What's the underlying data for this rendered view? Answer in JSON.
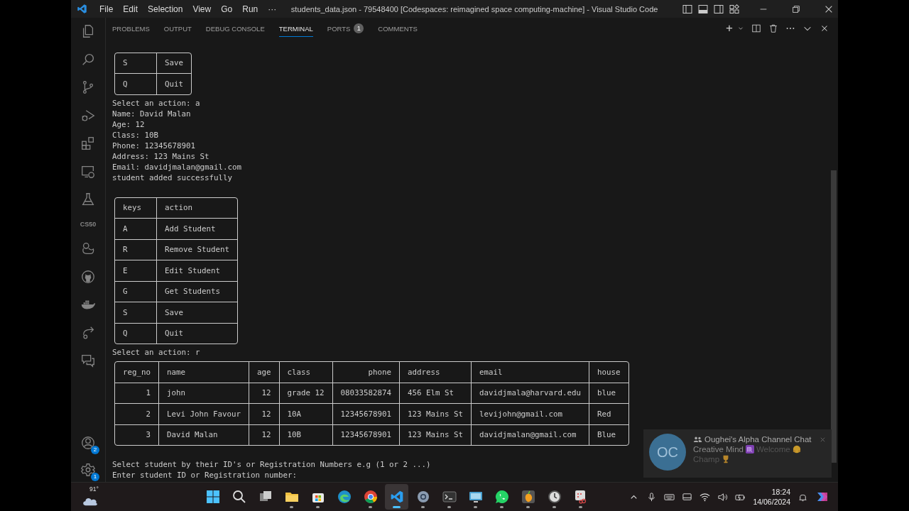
{
  "title_bar": {
    "menus": [
      "File",
      "Edit",
      "Selection",
      "View",
      "Go",
      "Run",
      "···"
    ],
    "title": "students_data.json - 79548400 [Codespaces: reimagined space computing-machine] - Visual Studio Code"
  },
  "activity_bar": {
    "top": [
      {
        "kind": "explorer"
      },
      {
        "kind": "search"
      },
      {
        "kind": "source-control"
      },
      {
        "kind": "run-debug"
      },
      {
        "kind": "extensions"
      },
      {
        "kind": "remote"
      },
      {
        "kind": "testing"
      },
      {
        "kind": "label",
        "label": "CS50"
      },
      {
        "kind": "duck"
      },
      {
        "kind": "github"
      },
      {
        "kind": "docker"
      },
      {
        "kind": "share"
      },
      {
        "kind": "chat"
      }
    ],
    "bottom": [
      {
        "kind": "account",
        "badge": "2"
      },
      {
        "kind": "settings",
        "badge": "1"
      }
    ]
  },
  "panel": {
    "tabs": [
      {
        "label": "PROBLEMS",
        "selected": false
      },
      {
        "label": "OUTPUT",
        "selected": false
      },
      {
        "label": "DEBUG CONSOLE",
        "selected": false
      },
      {
        "label": "TERMINAL",
        "selected": true
      },
      {
        "label": "PORTS",
        "selected": false,
        "badge": "1"
      },
      {
        "label": "COMMENTS",
        "selected": false
      }
    ],
    "actions": [
      "+"
    ]
  },
  "terminal": {
    "blocks": [
      {
        "kind": "table",
        "rows": [
          [
            "S",
            "Save"
          ],
          [
            "Q",
            "Quit"
          ]
        ]
      },
      {
        "kind": "line",
        "text": "Select an action: a"
      },
      {
        "kind": "line",
        "text": "Name: David Malan"
      },
      {
        "kind": "line",
        "text": "Age: 12"
      },
      {
        "kind": "line",
        "text": "Class: 10B"
      },
      {
        "kind": "line",
        "text": "Phone: 12345678901"
      },
      {
        "kind": "line",
        "text": "Address: 123 Mains St"
      },
      {
        "kind": "line",
        "text": "Email: davidjmalan@gmail.com"
      },
      {
        "kind": "line",
        "text": "student added successfully"
      },
      {
        "kind": "blank"
      },
      {
        "kind": "table",
        "columns": [
          {
            "label": "keys",
            "right_aligned": false
          },
          {
            "label": "action",
            "right_aligned": false
          }
        ],
        "rows": [
          [
            "A",
            "Add Student"
          ],
          [
            "R",
            "Remove Student"
          ],
          [
            "E",
            "Edit Student"
          ],
          [
            "G",
            "Get Students"
          ],
          [
            "S",
            "Save"
          ],
          [
            "Q",
            "Quit"
          ]
        ]
      },
      {
        "kind": "line",
        "text": "Select an action: r"
      },
      {
        "kind": "table",
        "columns": [
          {
            "label": "reg_no",
            "right_aligned": true
          },
          {
            "label": "name",
            "right_aligned": false
          },
          {
            "label": "age",
            "right_aligned": true
          },
          {
            "label": "class",
            "right_aligned": false
          },
          {
            "label": "phone",
            "right_aligned": true
          },
          {
            "label": "address",
            "right_aligned": false
          },
          {
            "label": "email",
            "right_aligned": false
          },
          {
            "label": "house",
            "right_aligned": false
          }
        ],
        "rows": [
          [
            "1",
            "john",
            "12",
            "grade 12",
            "08033582874",
            "456 Elm St",
            "davidjmala@harvard.edu",
            "blue"
          ],
          [
            "2",
            "Levi John Favour",
            "12",
            "10A",
            "12345678901",
            "123 Mains St",
            "levijohn@gmail.com",
            "Red"
          ],
          [
            "3",
            "David Malan",
            "12",
            "10B",
            "12345678901",
            "123 Mains St",
            "davidjmalan@gmail.com",
            "Blue"
          ]
        ]
      },
      {
        "kind": "blank"
      },
      {
        "kind": "line",
        "text": "Select student by their ID's or Registration Numbers e.g (1 or 2 ...)"
      },
      {
        "kind": "line",
        "text": "Enter student ID or Registration number:"
      }
    ]
  },
  "notification": {
    "avatar": "OC",
    "title": "Oughei's Alpha Channel Chat",
    "sender": "Creative Mind",
    "message": [
      "Welcome",
      "Champ"
    ]
  },
  "taskbar": {
    "weather": "91°",
    "apps": [
      {
        "kind": "start",
        "running": false,
        "selected": false
      },
      {
        "kind": "search",
        "running": false,
        "selected": false
      },
      {
        "kind": "task-view",
        "running": false,
        "selected": false
      },
      {
        "kind": "folder",
        "running": true,
        "selected": false
      },
      {
        "kind": "store",
        "running": true,
        "selected": false
      },
      {
        "kind": "edge",
        "running": false,
        "selected": false
      },
      {
        "kind": "chrome",
        "running": true,
        "selected": false
      },
      {
        "kind": "vscode",
        "running": true,
        "selected": true
      },
      {
        "kind": "gear",
        "running": true,
        "selected": false
      },
      {
        "kind": "terminal",
        "running": true,
        "selected": false
      },
      {
        "kind": "monitor",
        "running": true,
        "selected": false
      },
      {
        "kind": "whatsapp",
        "running": true,
        "selected": false
      },
      {
        "kind": "fruit",
        "running": true,
        "selected": false
      },
      {
        "kind": "clock",
        "running": true,
        "selected": false
      },
      {
        "kind": "scissors",
        "running": true,
        "selected": false
      }
    ],
    "time": "18:24",
    "date": "14/06/2024"
  }
}
